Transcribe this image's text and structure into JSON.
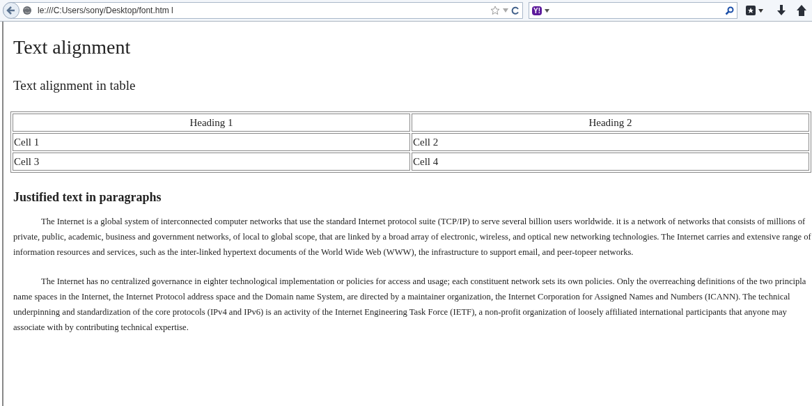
{
  "browser": {
    "address": "le:///C:Users/sony/Desktop/font.htm l",
    "search_logo": "Y!"
  },
  "page": {
    "title": "Text alignment",
    "subtitle": "Text alignment in table",
    "table": {
      "columns": [
        "Heading 1",
        "Heading 2"
      ],
      "rows": [
        [
          "Cell 1",
          "Cell 2"
        ],
        [
          "Cell 3",
          "Cell 4"
        ]
      ]
    },
    "section_heading": "Justified text in paragraphs",
    "paragraphs": [
      "The Internet is a global system of interconnected computer networks that use the standard Internet protocol suite (TCP/IP) to serve several billion users worldwide. it is a network of networks that consists of millions of private, public, academic, business and government networks, of local to global scope, that are linked by a broad array of electronic, wireless, and optical new networking technologies. The Internet carries and extensive range of information resources and services, such as the inter-linked hypertext documents of the World Wide Web (WWW), the infrastructure to support email, and peer-topeer networks.",
      "The Internet has no centralized governance in eighter technological implementation or policies for access and usage; each constituent network sets its own policies. Only the overreaching definitions of the two principla name spaces in the Internet, the Internet Protocol address space and the Domain name System, are directed by a maintainer organization, the Internet Corporation for Assigned Names and Numbers (ICANN). The technical underpinning and standardization of the core protocols (IPv4 and IPv6) is an activity of the Internet Engineering Task Force (IETF), a non-profit organization of loosely affiliated international participants that anyone may associate with by contributing technical expertise."
    ]
  }
}
